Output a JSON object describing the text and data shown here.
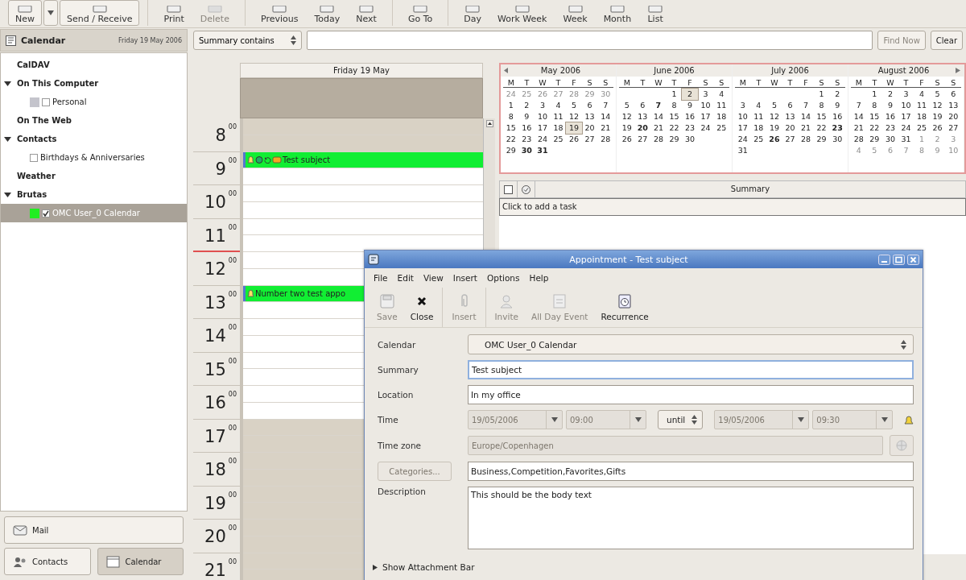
{
  "toolbar": [
    [
      {
        "label": "New",
        "kind": "split",
        "disabled": false
      },
      {
        "label": "Send / Receive",
        "kind": "plain",
        "disabled": false
      }
    ],
    [
      {
        "label": "Print",
        "kind": "plain",
        "disabled": false
      },
      {
        "label": "Delete",
        "kind": "plain",
        "disabled": true
      }
    ],
    [
      {
        "label": "Previous",
        "kind": "plain",
        "disabled": false
      },
      {
        "label": "Today",
        "kind": "plain",
        "disabled": false
      },
      {
        "label": "Next",
        "kind": "plain",
        "disabled": false
      }
    ],
    [
      {
        "label": "Go To",
        "kind": "plain",
        "disabled": false
      }
    ],
    [
      {
        "label": "Day",
        "kind": "plain",
        "disabled": false
      },
      {
        "label": "Work Week",
        "kind": "plain",
        "disabled": false
      },
      {
        "label": "Week",
        "kind": "plain",
        "disabled": false
      },
      {
        "label": "Month",
        "kind": "plain",
        "disabled": false
      },
      {
        "label": "List",
        "kind": "plain",
        "disabled": false
      }
    ]
  ],
  "sidebar": {
    "title": "Calendar",
    "date": "Friday 19 May 2006",
    "tree": [
      {
        "label": "CalDAV"
      },
      {
        "label": "On This Computer",
        "expanded": true,
        "children": [
          {
            "label": "Personal",
            "color": "#c4c4cc",
            "checked": false,
            "selected": false
          }
        ]
      },
      {
        "label": "On The Web"
      },
      {
        "label": "Contacts",
        "expanded": true,
        "children": [
          {
            "label": "Birthdays & Anniversaries",
            "checked": false,
            "selected": false
          }
        ]
      },
      {
        "label": "Weather"
      },
      {
        "label": "Brutas",
        "expanded": true,
        "children": [
          {
            "label": "OMC User_0 Calendar",
            "color": "#22ee22",
            "checked": true,
            "selected": true
          }
        ]
      }
    ],
    "switcher": [
      {
        "label": "Mail",
        "selected": false
      },
      {
        "label": "Contacts",
        "selected": false
      },
      {
        "label": "Calendar",
        "selected": true
      }
    ]
  },
  "search": {
    "field": "Summary contains",
    "buttons": [
      {
        "label": "Find Now",
        "disabled": true
      },
      {
        "label": "Clear",
        "disabled": false
      }
    ]
  },
  "day_view": {
    "header": "Friday 19 May",
    "hours": [
      {
        "hour": "8",
        "minutes": "00",
        "working": false,
        "current": false
      },
      {
        "hour": "9",
        "minutes": "00",
        "working": true,
        "current": false,
        "events": [
          {
            "title": "Test subject",
            "kind": "meeting"
          }
        ]
      },
      {
        "hour": "10",
        "minutes": "00",
        "working": true,
        "current": false
      },
      {
        "hour": "11",
        "minutes": "00",
        "working": true,
        "current": true
      },
      {
        "hour": "12",
        "minutes": "00",
        "working": true,
        "current": false
      },
      {
        "hour": "13",
        "minutes": "00",
        "working": true,
        "current": false,
        "events": [
          {
            "title": "Number two test appo",
            "kind": "alarm"
          }
        ]
      },
      {
        "hour": "14",
        "minutes": "00",
        "working": true,
        "current": false
      },
      {
        "hour": "15",
        "minutes": "00",
        "working": true,
        "current": false
      },
      {
        "hour": "16",
        "minutes": "00",
        "working": true,
        "current": false
      },
      {
        "hour": "17",
        "minutes": "00",
        "working": false,
        "current": false
      },
      {
        "hour": "18",
        "minutes": "00",
        "working": false,
        "current": false
      },
      {
        "hour": "19",
        "minutes": "00",
        "working": false,
        "current": false
      },
      {
        "hour": "20",
        "minutes": "00",
        "working": false,
        "current": false
      },
      {
        "hour": "21",
        "minutes": "00",
        "working": false,
        "current": false
      }
    ]
  },
  "mini_calendar": [
    {
      "title": "May 2006",
      "weekdays": [
        "M",
        "T",
        "W",
        "T",
        "F",
        "S",
        "S"
      ],
      "prev_days": [
        "24",
        "25",
        "26",
        "27",
        "28",
        "29",
        "30"
      ],
      "weeks": [
        [
          "1",
          "2",
          "3",
          "4",
          "5",
          "6",
          "7"
        ],
        [
          "8",
          "9",
          "10",
          "11",
          "12",
          "13",
          "14"
        ],
        [
          "15",
          "16",
          "17",
          "18",
          {
            "text": "19",
            "boxed": true
          },
          "20",
          "21"
        ],
        [
          "22",
          "23",
          "24",
          "25",
          "26",
          "27",
          "28"
        ],
        [
          "29",
          "**30**",
          "**31**"
        ]
      ]
    },
    {
      "title": "June 2006",
      "weekdays": [
        "M",
        "T",
        "W",
        "T",
        "F",
        "S",
        "S"
      ],
      "weeks": [
        [
          "1",
          {
            "text": "2",
            "boxed": true
          },
          "3",
          "4"
        ],
        [
          "5",
          "6",
          "**7**",
          "8",
          "9",
          "10",
          "11"
        ],
        [
          "12",
          "13",
          "14",
          "15",
          "16",
          "17",
          "18"
        ],
        [
          "19",
          "**20**",
          "21",
          "22",
          "23",
          "24",
          "25"
        ],
        [
          "26",
          "27",
          "28",
          "29",
          "30"
        ]
      ]
    },
    {
      "title": "July 2006",
      "weekdays": [
        "M",
        "T",
        "W",
        "T",
        "F",
        "S",
        "S"
      ],
      "weeks": [
        [
          "1",
          "2"
        ],
        [
          "3",
          "4",
          "5",
          "6",
          "7",
          "8",
          "9"
        ],
        [
          "10",
          "11",
          "12",
          "13",
          "14",
          "15",
          "16"
        ],
        [
          "17",
          "18",
          "19",
          "20",
          "21",
          "22",
          "**23**"
        ],
        [
          "24",
          "25",
          "**26**",
          "27",
          "28",
          "29",
          "30"
        ],
        [
          "31"
        ]
      ]
    },
    {
      "title": "August 2006",
      "weekdays": [
        "M",
        "T",
        "W",
        "T",
        "F",
        "S",
        "S"
      ],
      "weeks": [
        [
          "1",
          "2",
          "3",
          "4",
          "5",
          "6"
        ],
        [
          "7",
          "8",
          "9",
          "10",
          "11",
          "12",
          "13"
        ],
        [
          "14",
          "15",
          "16",
          "17",
          "18",
          "19",
          "20"
        ],
        [
          "21",
          "22",
          "23",
          "24",
          "25",
          "26",
          "27"
        ],
        [
          "28",
          "29",
          "30",
          "31"
        ]
      ],
      "next_days": [
        "1",
        "2",
        "3",
        "4",
        "5",
        "6",
        "7",
        "8",
        "9",
        "10"
      ]
    }
  ],
  "tasks": {
    "header": "Summary",
    "add_row": "Click to add a task"
  },
  "dialog": {
    "title": "Appointment - Test subject",
    "menu": [
      "File",
      "Edit",
      "View",
      "Insert",
      "Options",
      "Help"
    ],
    "tools": [
      [
        {
          "label": "Save",
          "disabled": true
        },
        {
          "label": "Close",
          "disabled": false
        }
      ],
      [
        {
          "label": "Insert",
          "disabled": true
        }
      ],
      [
        {
          "label": "Invite",
          "disabled": true
        },
        {
          "label": "All Day Event",
          "disabled": true
        },
        {
          "label": "Recurrence",
          "disabled": false
        }
      ]
    ],
    "calendar": {
      "label": "Calendar",
      "value": "OMC User_0 Calendar"
    },
    "summary": {
      "label": "Summary",
      "value": "Test subject",
      "focused": true
    },
    "location": {
      "label": "Location",
      "value": "In my office",
      "focused": false
    },
    "time": {
      "label": "Time",
      "start_date": "19/05/2006",
      "start_time": "09:00",
      "mode": "until",
      "end_date": "19/05/2006",
      "end_time": "09:30",
      "disabled": true
    },
    "timezone": {
      "label": "Time zone",
      "value": "Europe/Copenhagen",
      "disabled": true
    },
    "categories": {
      "button": "Categories...",
      "disabled": true,
      "value": "Business,Competition,Favorites,Gifts"
    },
    "description": {
      "label": "Description",
      "value": "This should be the body text"
    },
    "attachment_bar": {
      "label": "Show Attachment Bar",
      "expanded": false
    }
  }
}
